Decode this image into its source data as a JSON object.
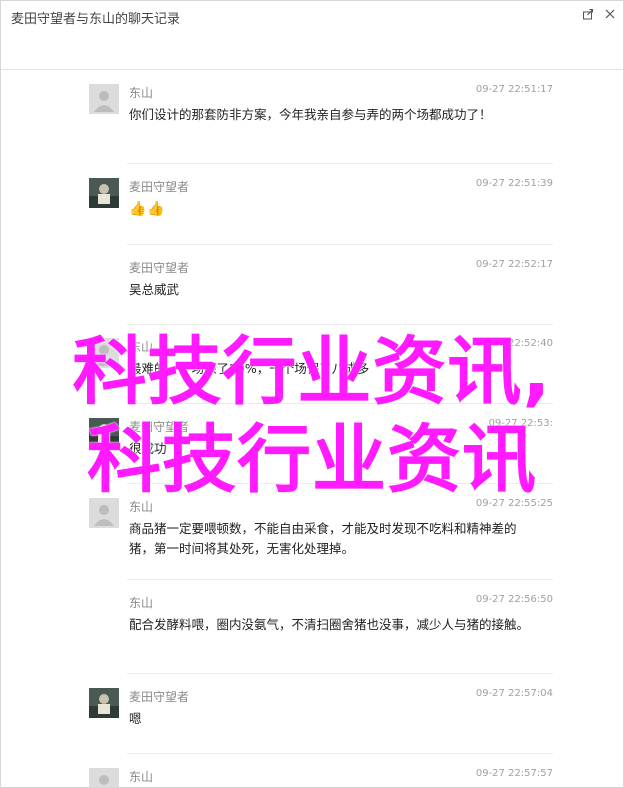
{
  "window": {
    "title": "麦田守望者与东山的聊天记录"
  },
  "messages": [
    {
      "sender": "东山",
      "time": "09-27 22:51:17",
      "text": "你们设计的那套防非方案，今年我亲自参与弄的两个场都成功了！",
      "avatar": "default-avatar"
    },
    {
      "sender": "麦田守望者",
      "time": "09-27 22:51:39",
      "text": "👍👍",
      "avatar": "photo-avatar"
    },
    {
      "sender": "麦田守望者",
      "time": "09-27 22:52:17",
      "text": "吴总威武",
      "avatar": "none"
    },
    {
      "sender": "东山",
      "time": "09-27 22:52:40",
      "text": "最难的一个场保了50%，一个场保了八成多",
      "avatar": "default-avatar"
    },
    {
      "sender": "麦田守望者",
      "time": "09-27 22:53:",
      "text": "很成功",
      "avatar": "photo-avatar"
    },
    {
      "sender": "东山",
      "time": "09-27 22:55:25",
      "text": "商品猪一定要喂顿数，不能自由采食，才能及时发现不吃料和精神差的猪，第一时间将其处死，无害化处理掉。",
      "avatar": "default-avatar"
    },
    {
      "sender": "东山",
      "time": "09-27 22:56:50",
      "text": "配合发酵料喂，圈内没氨气，不清扫圈舍猪也没事，减少人与猪的接触。",
      "avatar": "none"
    },
    {
      "sender": "麦田守望者",
      "time": "09-27 22:57:04",
      "text": "嗯",
      "avatar": "photo-avatar"
    },
    {
      "sender": "东山",
      "time": "09-27 22:57:57",
      "text": "",
      "avatar": "default-avatar"
    }
  ],
  "watermark": {
    "line1": "科技行业资讯,",
    "line2": "科技行业资讯"
  },
  "colors": {
    "watermark": "#ff1aff",
    "sender": "#8a8a8a",
    "time": "#a0a0a0"
  },
  "icons": {
    "export": "export-icon",
    "close": "close-icon",
    "default_avatar": "person-icon"
  }
}
